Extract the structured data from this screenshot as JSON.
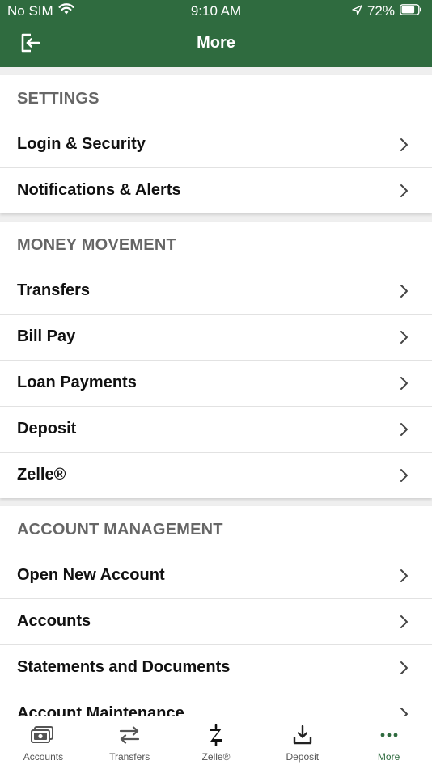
{
  "status_bar": {
    "carrier": "No SIM",
    "time": "9:10 AM",
    "battery": "72%"
  },
  "nav": {
    "title": "More"
  },
  "sections": [
    {
      "header": "SETTINGS",
      "items": [
        "Login & Security",
        "Notifications & Alerts"
      ]
    },
    {
      "header": "MONEY MOVEMENT",
      "items": [
        "Transfers",
        "Bill Pay",
        "Loan Payments",
        "Deposit",
        "Zelle®"
      ]
    },
    {
      "header": "ACCOUNT MANAGEMENT",
      "items": [
        "Open New Account",
        "Accounts",
        "Statements and Documents",
        "Account Maintenance"
      ]
    }
  ],
  "tab_bar": {
    "tabs": [
      {
        "label": "Accounts",
        "icon": "accounts-icon"
      },
      {
        "label": "Transfers",
        "icon": "transfers-icon"
      },
      {
        "label": "Zelle®",
        "icon": "zelle-icon"
      },
      {
        "label": "Deposit",
        "icon": "deposit-icon"
      },
      {
        "label": "More",
        "icon": "more-icon"
      }
    ],
    "active": "More"
  },
  "colors": {
    "brand_green": "#2f6b3f",
    "section_header": "#666666"
  }
}
